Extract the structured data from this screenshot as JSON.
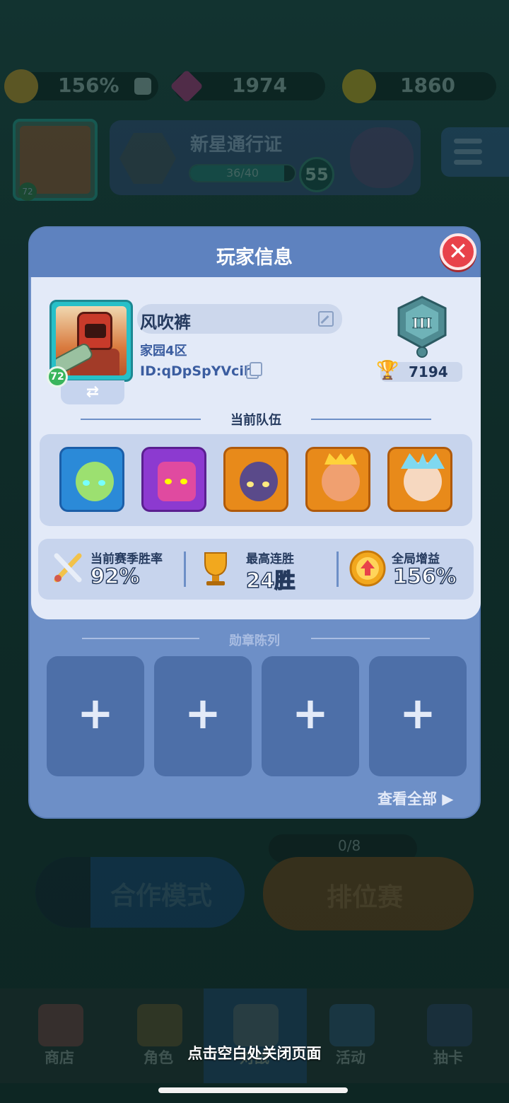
{
  "resources": {
    "boost": "156%",
    "gems": "1974",
    "coins": "1860"
  },
  "profile_avatar_level": "72",
  "pass": {
    "title": "新星通行证",
    "progress_text": "36/40",
    "progress": 0.9,
    "level": "55"
  },
  "modal": {
    "title": "玩家信息",
    "player": {
      "name": "风吹裤",
      "region": "家园4区",
      "id": "ID:qDpSpYVcih",
      "level": "72",
      "rank_numeral": "III",
      "trophies": "7194"
    },
    "team_title": "当前队伍",
    "team": [
      {
        "name": "hero-1",
        "color": "#2b8ad8"
      },
      {
        "name": "hero-2",
        "color": "#8c3ad0"
      },
      {
        "name": "hero-3",
        "color": "#e88a1a"
      },
      {
        "name": "hero-4",
        "color": "#e88a1a"
      },
      {
        "name": "hero-5",
        "color": "#e88a1a"
      }
    ],
    "stats": [
      {
        "label": "当前赛季胜率",
        "value": "92%",
        "icon": "crossed-swords-icon"
      },
      {
        "label": "最高连胜",
        "value": "24胜",
        "icon": "trophy-icon"
      },
      {
        "label": "全局增益",
        "value": "156%",
        "icon": "boost-up-icon"
      }
    ],
    "medals_title": "勋章陈列",
    "medal_slots": [
      "+",
      "+",
      "+",
      "+"
    ],
    "view_all": "查看全部 ▶"
  },
  "lobby": {
    "coop_label": "合作模式",
    "ranked_label": "排位赛",
    "ranked_count": "0/8"
  },
  "nav": [
    {
      "label": "商店"
    },
    {
      "label": "角色"
    },
    {
      "label": "对战"
    },
    {
      "label": "活动"
    },
    {
      "label": "抽卡"
    }
  ],
  "close_hint": "点击空白处关闭页面",
  "colors": {
    "modal_bg": "#6d8fc7",
    "modal_body": "#e3eaf8",
    "close_red": "#e8424a",
    "accent_gold": "#f2a81e"
  }
}
